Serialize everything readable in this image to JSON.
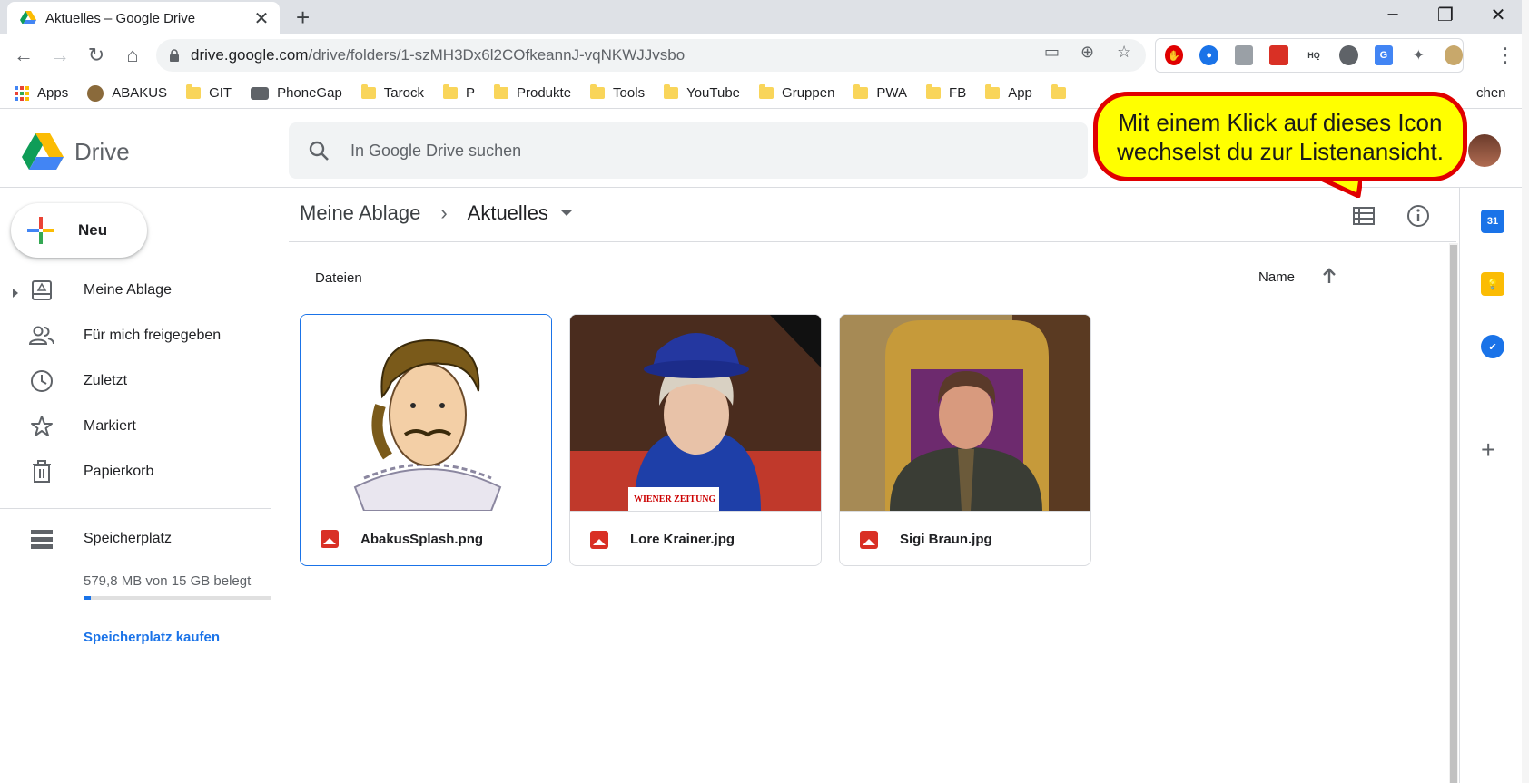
{
  "browser": {
    "tab_title": "Aktuelles – Google Drive",
    "url_host": "drive.google.com",
    "url_path": "/drive/folders/1-szMH3Dx6l2COfkeannJ-vqNKWJJvsbo",
    "bookmarks": [
      {
        "label": "Apps",
        "icon": "apps-grid-icon"
      },
      {
        "label": "ABAKUS",
        "icon": "abakus-icon"
      },
      {
        "label": "GIT",
        "icon": "folder-icon"
      },
      {
        "label": "PhoneGap",
        "icon": "phonegap-icon"
      },
      {
        "label": "Tarock",
        "icon": "folder-icon"
      },
      {
        "label": "P",
        "icon": "folder-icon"
      },
      {
        "label": "Produkte",
        "icon": "folder-icon"
      },
      {
        "label": "Tools",
        "icon": "folder-icon"
      },
      {
        "label": "YouTube",
        "icon": "folder-icon"
      },
      {
        "label": "Gruppen",
        "icon": "folder-icon"
      },
      {
        "label": "PWA",
        "icon": "folder-icon"
      },
      {
        "label": "FB",
        "icon": "folder-icon"
      },
      {
        "label": "App",
        "icon": "folder-icon"
      }
    ],
    "bookmark_overflow": "chen"
  },
  "drive": {
    "logo_text": "Drive",
    "search_placeholder": "In Google Drive suchen",
    "new_button": "Neu",
    "nav": [
      {
        "label": "Meine Ablage",
        "icon": "my-drive-icon"
      },
      {
        "label": "Für mich freigegeben",
        "icon": "shared-icon"
      },
      {
        "label": "Zuletzt",
        "icon": "clock-icon"
      },
      {
        "label": "Markiert",
        "icon": "star-icon"
      },
      {
        "label": "Papierkorb",
        "icon": "trash-icon"
      }
    ],
    "storage": {
      "label": "Speicherplatz",
      "usage_text": "579,8 MB von 15 GB belegt",
      "used_fraction": 0.038,
      "buy_link": "Speicherplatz kaufen"
    },
    "breadcrumb": {
      "root": "Meine Ablage",
      "current": "Aktuelles"
    },
    "section_label": "Dateien",
    "sort_label": "Name",
    "files": [
      {
        "name": "AbakusSplash.png",
        "selected": true
      },
      {
        "name": "Lore Krainer.jpg",
        "selected": false
      },
      {
        "name": "Sigi Braun.jpg",
        "selected": false
      }
    ],
    "thumb_text_wiener": "WIENER ZEITUNG"
  },
  "callout": {
    "line1": "Mit einem Klick auf dieses Icon",
    "line2": "wechselst du zur Listenansicht."
  },
  "side_apps": {
    "calendar_day": "31"
  },
  "colors": {
    "accent": "#1a73e8",
    "callout_fill": "#ffff00",
    "callout_border": "#e00000"
  }
}
